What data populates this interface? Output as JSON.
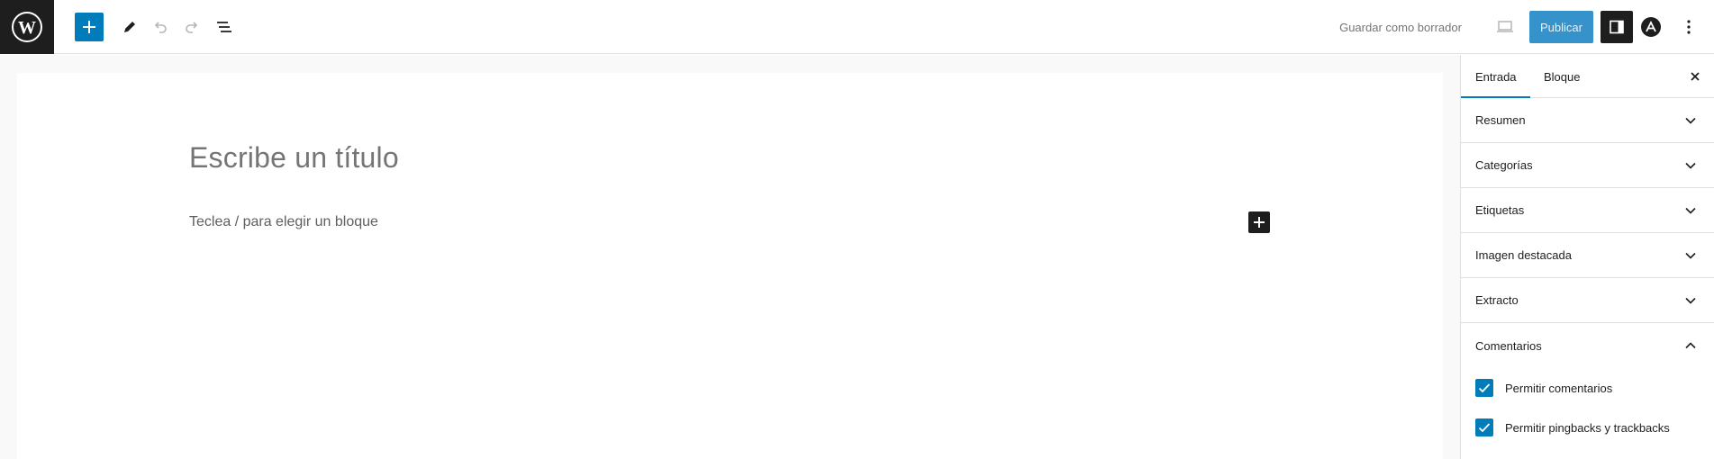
{
  "toolbar": {
    "save_draft_label": "Guardar como borrador",
    "publish_label": "Publicar",
    "icons": [
      "wordpress-logo",
      "plus",
      "pencil",
      "undo",
      "redo",
      "list-view",
      "desktop-preview",
      "sidebar-toggle",
      "astra-logo",
      "more-vertical"
    ]
  },
  "editor": {
    "title_placeholder": "Escribe un título",
    "block_placeholder": "Teclea / para elegir un bloque"
  },
  "sidebar": {
    "tabs": [
      {
        "label": "Entrada",
        "active": true
      },
      {
        "label": "Bloque",
        "active": false
      }
    ],
    "panels": [
      {
        "label": "Resumen",
        "expanded": false
      },
      {
        "label": "Categorías",
        "expanded": false
      },
      {
        "label": "Etiquetas",
        "expanded": false
      },
      {
        "label": "Imagen destacada",
        "expanded": false
      },
      {
        "label": "Extracto",
        "expanded": false
      },
      {
        "label": "Comentarios",
        "expanded": true
      }
    ],
    "comments": {
      "allow_comments_label": "Permitir comentarios",
      "allow_comments_checked": true,
      "allow_pingbacks_label": "Permitir pingbacks y trackbacks",
      "allow_pingbacks_checked": true
    }
  },
  "colors": {
    "accent": "#007cba",
    "publish_bg": "#3592cb",
    "dark": "#1e1e1e"
  }
}
